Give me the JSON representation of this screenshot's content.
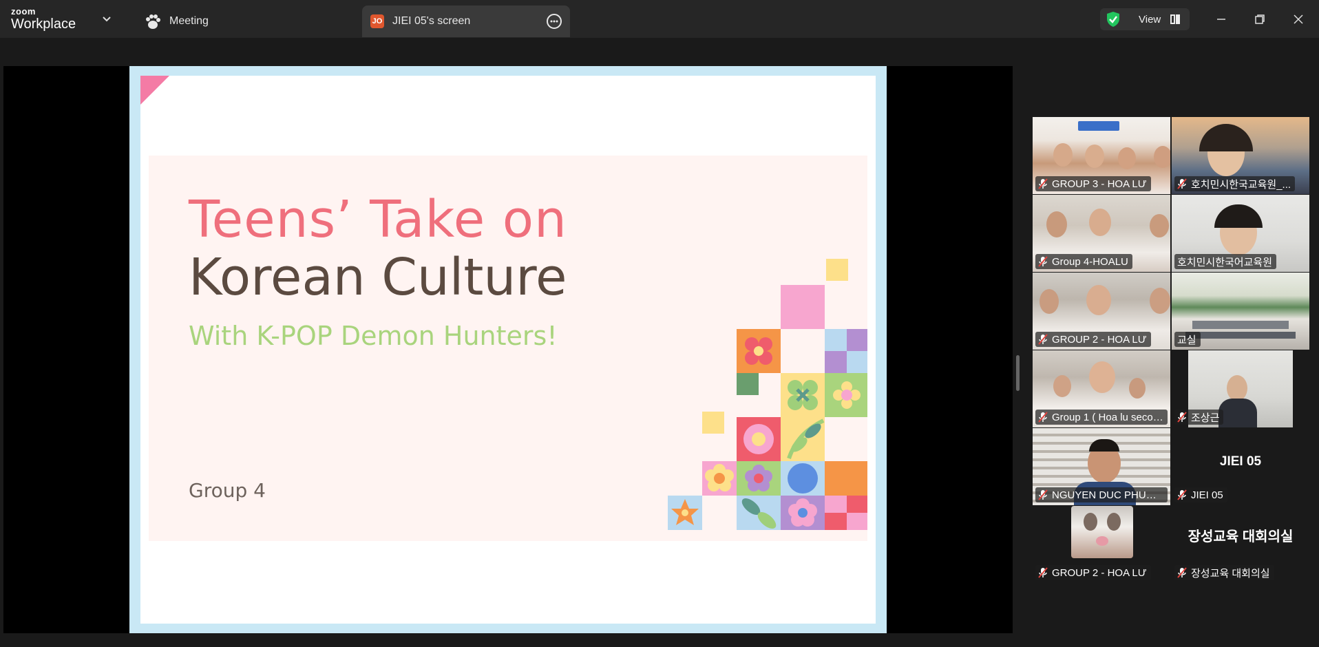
{
  "app": {
    "logo_small": "zoom",
    "logo_big": "Workplace"
  },
  "tabs": {
    "meeting_label": "Meeting",
    "screen_badge": "JO",
    "screen_label": "JIEI 05's screen"
  },
  "toolbar": {
    "view_label": "View",
    "icons": [
      "shield-check-icon",
      "gallery-view-icon",
      "minimize-icon",
      "restore-icon",
      "close-icon"
    ]
  },
  "slide": {
    "title_line1": "Teens’ Take on",
    "title_line2": "Korean Culture",
    "subtitle": "With K-POP Demon Hunters!",
    "group": "Group 4"
  },
  "participants": [
    {
      "name": "GROUP 3 - HOA LƯ"
    },
    {
      "name": "호치민시한국교육원_..."
    },
    {
      "name": "Group 4-HOALU"
    },
    {
      "name": "호치민시한국어교육원"
    },
    {
      "name": "GROUP 2 - HOA LƯ"
    },
    {
      "name": "교실"
    },
    {
      "name": "Group 1 ( Hoa lu secon..."
    },
    {
      "name": "조상근"
    },
    {
      "name": "NGUYEN DUC PHUON..."
    },
    {
      "name": "JIEI 05",
      "display": "JIEI 05"
    },
    {
      "name": "GROUP 2 - HOA LƯ"
    },
    {
      "name": "장성교육 대회의실",
      "display": "장성교육 대회의실"
    }
  ],
  "colors": {
    "active_speaker": "#2fd18a",
    "title_pink": "#ef6f7c",
    "title_brown": "#5b4a40",
    "subtitle_green": "#a9d47d"
  }
}
